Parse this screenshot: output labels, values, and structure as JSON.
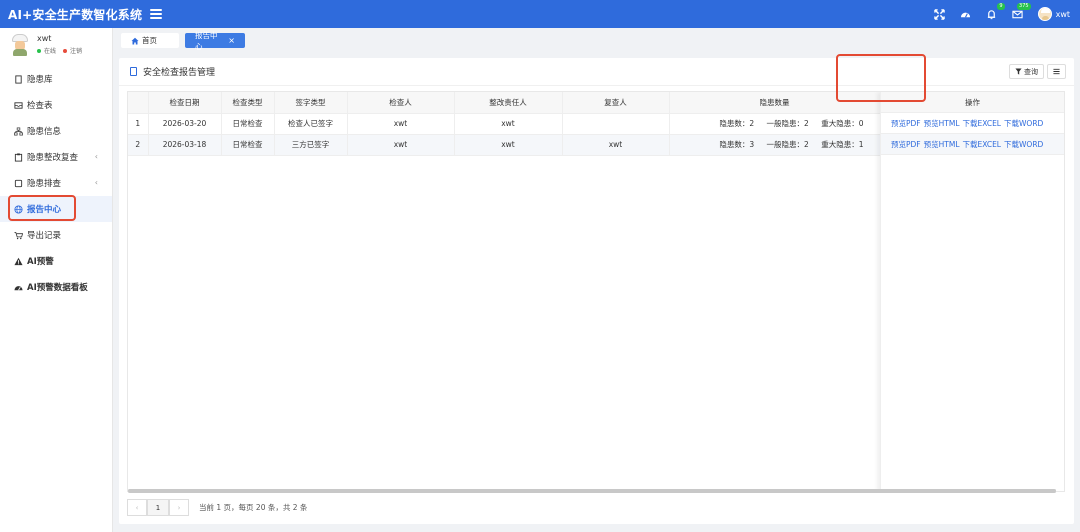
{
  "header": {
    "app_title": "AI+安全生产数智化系统",
    "badge_bell": "9",
    "badge_mail": "375",
    "user_name": "xwt"
  },
  "sidebar": {
    "profile_name": "xwt",
    "status_online": "在线",
    "status_logout": "注销",
    "items": [
      {
        "label": "隐患库"
      },
      {
        "label": "检查表"
      },
      {
        "label": "隐患信息"
      },
      {
        "label": "隐患整改复查"
      },
      {
        "label": "隐患排查"
      },
      {
        "label": "报告中心"
      },
      {
        "label": "导出记录"
      },
      {
        "label": "AI预警"
      },
      {
        "label": "AI预警数据看板"
      }
    ]
  },
  "tabs": {
    "home": "首页",
    "active": "报告中心"
  },
  "panel": {
    "title": "安全检查报告管理",
    "query_label": "查询"
  },
  "table": {
    "columns": [
      "检查日期",
      "检查类型",
      "签字类型",
      "检查人",
      "整改责任人",
      "复查人",
      "隐患数量",
      "操作"
    ],
    "rows": [
      {
        "index": "1",
        "date": "2026-03-20",
        "type": "日常检查",
        "sign": "检查人已签字",
        "inspector": "xwt",
        "responsible": "xwt",
        "reviewer": "",
        "total": "隐患数：2",
        "general": "一般隐患：2",
        "major": "重大隐患：0"
      },
      {
        "index": "2",
        "date": "2026-03-18",
        "type": "日常检查",
        "sign": "三方已签字",
        "inspector": "xwt",
        "responsible": "xwt",
        "reviewer": "xwt",
        "total": "隐患数：3",
        "general": "一般隐患：2",
        "major": "重大隐患：1"
      }
    ],
    "ops": {
      "preview_pdf": "预览PDF",
      "preview_html": "预览HTML",
      "download_excel": "下载EXCEL",
      "download_word": "下载WORD"
    }
  },
  "pagination": {
    "prev": "‹",
    "current": "1",
    "next": "›",
    "info": "当前  1  页，每页  20  条，共 2 条"
  }
}
